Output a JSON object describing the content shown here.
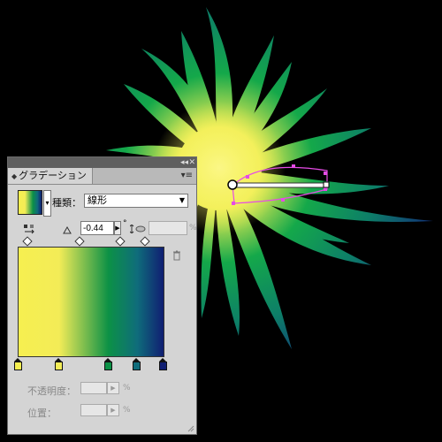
{
  "panel": {
    "collapse_label": "◂◂",
    "close_label": "✕",
    "tab_arrows": "◆",
    "tab_title": "グラデーション",
    "menu_label": "▾≡",
    "type_label": "種類：",
    "type_value": "線形",
    "type_caret": "▼",
    "angle_value": "-0.44",
    "angle_step": "▶",
    "degree_symbol": "°",
    "aspect_percent": "%",
    "opacity_label": "不透明度：",
    "opacity_percent": "%",
    "location_label": "位置：",
    "location_percent": "%",
    "disabled_step": "▶"
  },
  "gradient": {
    "stops": [
      {
        "color": "#f6ef50",
        "location": 0
      },
      {
        "color": "#f3ec57",
        "location": 28
      },
      {
        "color": "#0c9146",
        "location": 62
      },
      {
        "color": "#0f6c7b",
        "location": 82
      },
      {
        "color": "#101e72",
        "location": 100
      }
    ],
    "midpoints": [
      6,
      42,
      70,
      87
    ]
  },
  "colors": {
    "panel_bg": "#d4d4d4",
    "titlebar": "#5f5f5f",
    "selection": "#e64be6"
  }
}
